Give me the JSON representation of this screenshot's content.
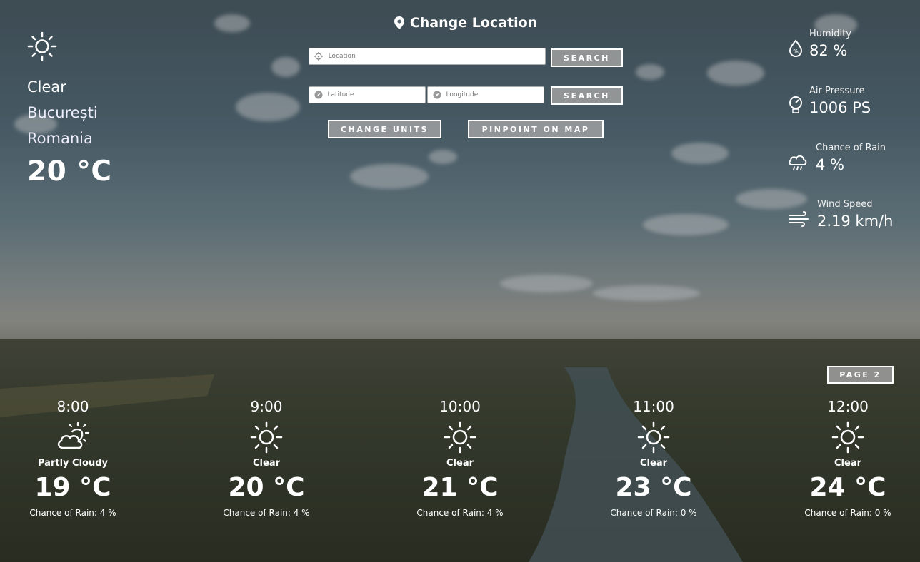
{
  "colors": {
    "button_bg": "#a0a0a0",
    "text": "#ffffff",
    "input_bg": "#ffffff"
  },
  "current": {
    "icon": "sun-icon",
    "condition": "Clear",
    "city": "București",
    "country": "Romania",
    "temperature": "20 °C"
  },
  "search": {
    "title": "Change Location",
    "title_icon": "map-pin-icon",
    "location_placeholder": "Location",
    "latitude_placeholder": "Latitude",
    "longitude_placeholder": "Longitude",
    "search_label": "SEARCH",
    "search_coords_label": "SEARCH",
    "change_units_label": "CHANGE UNITS",
    "pinpoint_label": "PINPOINT ON MAP"
  },
  "stats": {
    "humidity": {
      "icon": "humidity-drop-icon",
      "label": "Humidity",
      "value": "82 %"
    },
    "pressure": {
      "icon": "pressure-gauge-icon",
      "label": "Air Pressure",
      "value": "1006 PS"
    },
    "rain": {
      "icon": "rain-cloud-icon",
      "label": "Chance of Rain",
      "value": "4 %"
    },
    "wind": {
      "icon": "wind-icon",
      "label": "Wind Speed",
      "value": "2.19 km/h"
    }
  },
  "pagination": {
    "label": "PAGE 2"
  },
  "hourly": [
    {
      "time": "8:00",
      "icon": "partly-cloudy-icon",
      "condition": "Partly Cloudy",
      "temperature": "19 °C",
      "rain": "Chance of Rain: 4 %"
    },
    {
      "time": "9:00",
      "icon": "sun-icon",
      "condition": "Clear",
      "temperature": "20 °C",
      "rain": "Chance of Rain: 4 %"
    },
    {
      "time": "10:00",
      "icon": "sun-icon",
      "condition": "Clear",
      "temperature": "21 °C",
      "rain": "Chance of Rain: 4 %"
    },
    {
      "time": "11:00",
      "icon": "sun-icon",
      "condition": "Clear",
      "temperature": "23 °C",
      "rain": "Chance of Rain: 0 %"
    },
    {
      "time": "12:00",
      "icon": "sun-icon",
      "condition": "Clear",
      "temperature": "24 °C",
      "rain": "Chance of Rain: 0 %"
    }
  ]
}
